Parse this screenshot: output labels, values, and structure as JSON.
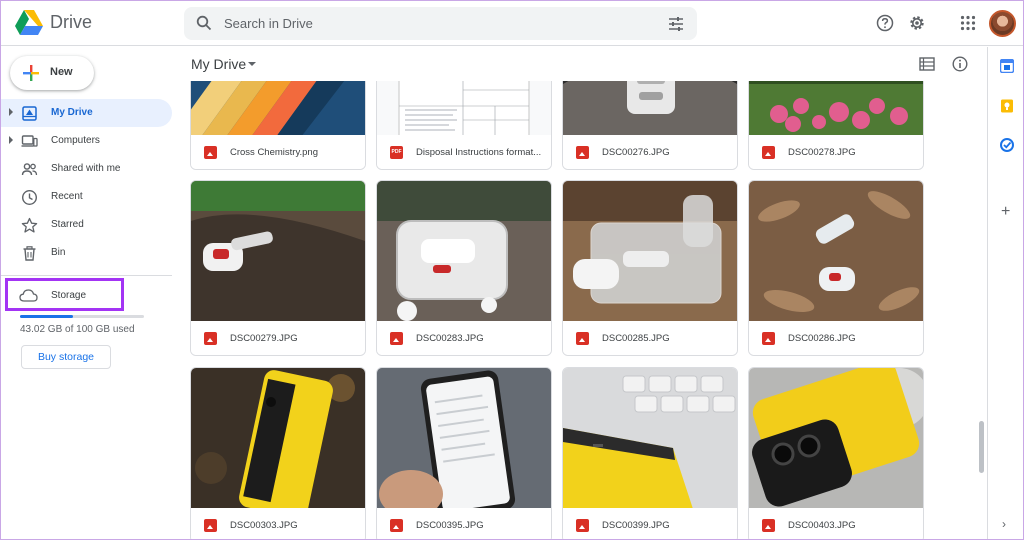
{
  "app": {
    "name": "Drive"
  },
  "search": {
    "placeholder": "Search in Drive"
  },
  "sidebar": {
    "new_label": "New",
    "items": [
      {
        "label": "My Drive",
        "icon": "my-drive-icon",
        "active": true,
        "expandable": true
      },
      {
        "label": "Computers",
        "icon": "computers-icon",
        "active": false,
        "expandable": true
      },
      {
        "label": "Shared with me",
        "icon": "shared-with-me-icon",
        "active": false,
        "expandable": false
      },
      {
        "label": "Recent",
        "icon": "clock-icon",
        "active": false,
        "expandable": false
      },
      {
        "label": "Starred",
        "icon": "star-icon",
        "active": false,
        "expandable": false
      },
      {
        "label": "Bin",
        "icon": "trash-icon",
        "active": false,
        "expandable": false
      }
    ],
    "storage": {
      "label": "Storage",
      "usage_text": "43.02 GB of 100 GB used",
      "used_fraction": 0.4302,
      "buy_label": "Buy storage"
    }
  },
  "main": {
    "title": "My Drive",
    "files": [
      {
        "name": "Cross Chemistry.png",
        "type": "image"
      },
      {
        "name": "Disposal Instructions format...",
        "type": "pdf"
      },
      {
        "name": "DSC00276.JPG",
        "type": "image"
      },
      {
        "name": "DSC00278.JPG",
        "type": "image"
      },
      {
        "name": "DSC00279.JPG",
        "type": "image"
      },
      {
        "name": "DSC00283.JPG",
        "type": "image"
      },
      {
        "name": "DSC00285.JPG",
        "type": "image"
      },
      {
        "name": "DSC00286.JPG",
        "type": "image"
      },
      {
        "name": "DSC00303.JPG",
        "type": "image"
      },
      {
        "name": "DSC00395.JPG",
        "type": "image"
      },
      {
        "name": "DSC00399.JPG",
        "type": "image"
      },
      {
        "name": "DSC00403.JPG",
        "type": "image"
      }
    ],
    "pdf_badge": "PDF"
  },
  "colors": {
    "accent": "#1a73e8",
    "active_bg": "#e8f0fe",
    "highlight_box": "#a334f4",
    "file_icon_red": "#d93025"
  }
}
